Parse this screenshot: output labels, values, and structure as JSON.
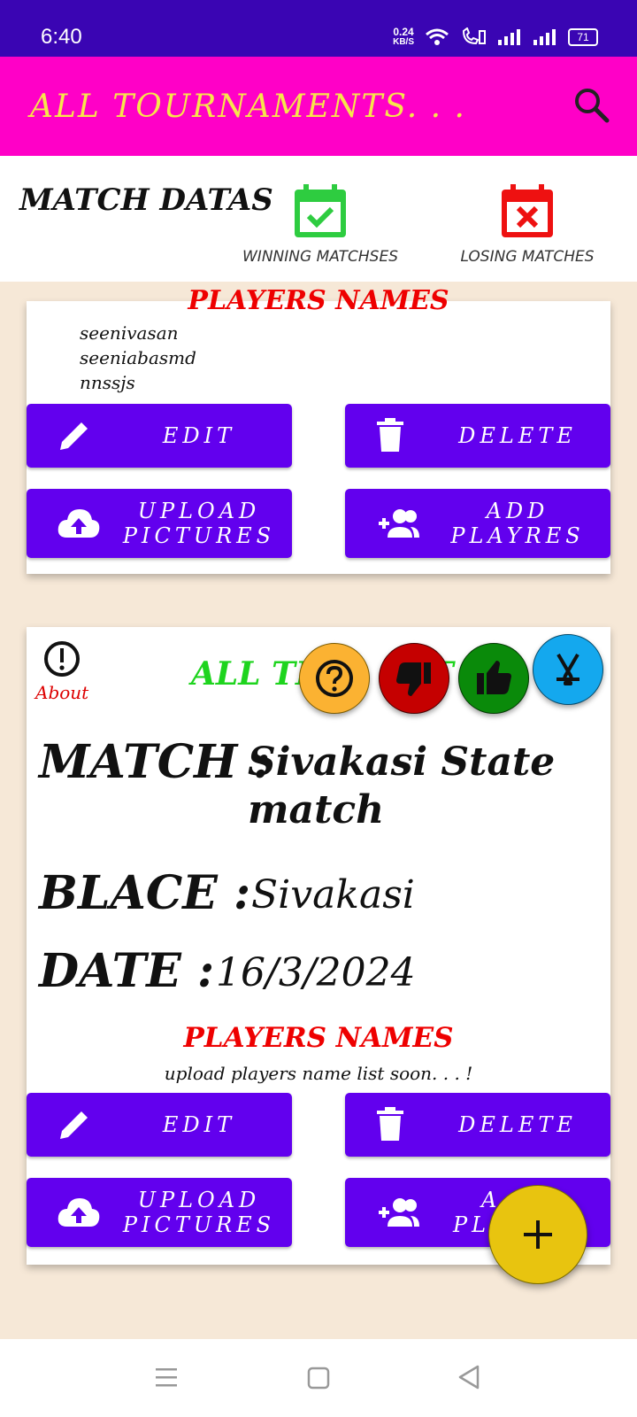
{
  "status_bar": {
    "time": "6:40",
    "net_speed_value": "0.24",
    "net_speed_unit": "KB/S",
    "battery": "71"
  },
  "app_bar": {
    "title": "ALL TOURNAMENTS. . .",
    "search_icon": "search-icon"
  },
  "match_tabs": {
    "title": "MATCH DATAS",
    "winning_label": "WINNING MATCHSES",
    "losing_label": "LOSING MATCHES",
    "winning_color": "#2ecc40",
    "losing_color": "#ee1111"
  },
  "card1": {
    "players_heading_partial": "PLAYERS NAMES",
    "players": [
      "seenivasan",
      "seeniabasmd",
      "nnssjs"
    ],
    "buttons": {
      "edit": "EDIT",
      "delete": "DELETE",
      "upload_line1": "UPLOAD",
      "upload_line2": "PICTURES",
      "add_line1": "ADD",
      "add_line2": "PLAYRES"
    }
  },
  "card2": {
    "about_label": "About",
    "title_visible": "ALL TH",
    "title_visible_tail": "T",
    "match_label": "MATCH :",
    "match_value": "Sivakasi State match",
    "place_label": "BLACE :",
    "place_value": "Sivakasi",
    "date_label": "DATE :",
    "date_value": "16/3/2024",
    "players_heading": "PLAYERS NAMES",
    "players_note": "upload players name list soon. . . !",
    "buttons": {
      "edit": "EDIT",
      "delete": "DELETE",
      "upload_line1": "UPLOAD",
      "upload_line2": "PICTURES",
      "add_line1": "A",
      "add_line2": "PLA"
    }
  },
  "fab_menu": {
    "help_color": "#fbb232",
    "dislike_color": "#c50000",
    "like_color": "#0a8a0a",
    "hockey_color": "#14a8ee"
  },
  "fab": {
    "symbol": "+",
    "color": "#e8c40f"
  },
  "accent": "#6200ee"
}
